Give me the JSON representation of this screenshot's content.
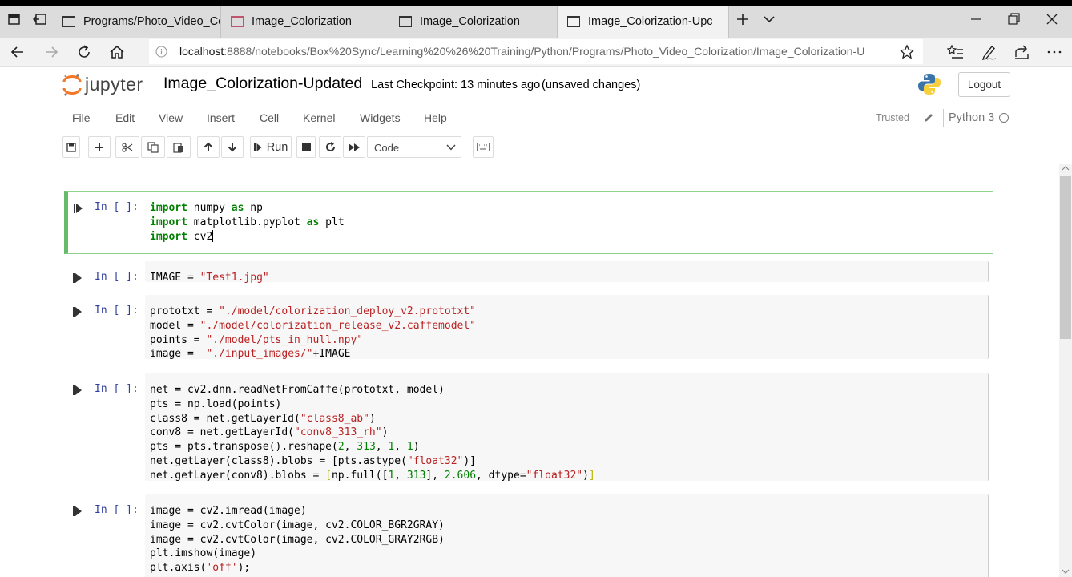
{
  "browser": {
    "tabs": [
      {
        "label": "Programs/Photo_Video_Col",
        "icon": "page-icon"
      },
      {
        "label": "Image_Colorization",
        "icon": "jupyter-page-icon"
      },
      {
        "label": "Image_Colorization",
        "icon": "page-icon"
      },
      {
        "label": "Image_Colorization-Upc",
        "icon": "page-icon",
        "active": true
      }
    ],
    "url_host": "localhost",
    "url_rest": ":8888/notebooks/Box%20Sync/Learning%20%26%20Training/Python/Programs/Photo_Video_Colorization/Image_Colorization-Update"
  },
  "jupyter": {
    "logo_text": "jupyter",
    "notebook_title": "Image_Colorization-Updated",
    "checkpoint": "Last Checkpoint: 13 minutes ago",
    "unsaved": "(unsaved changes)",
    "logout": "Logout",
    "menu": [
      "File",
      "Edit",
      "View",
      "Insert",
      "Cell",
      "Kernel",
      "Widgets",
      "Help"
    ],
    "trusted": "Trusted",
    "kernel_name": "Python 3",
    "toolbar": {
      "run_label": "Run",
      "cell_type": "Code"
    }
  },
  "cells": [
    {
      "prompt": "In [ ]:",
      "lines": [
        "import numpy as np",
        "import matplotlib.pyplot as plt",
        "import cv2"
      ]
    },
    {
      "prompt": "In [ ]:",
      "lines": [
        "IMAGE = \"Test1.jpg\""
      ]
    },
    {
      "prompt": "In [ ]:",
      "lines": [
        "prototxt = \"./model/colorization_deploy_v2.prototxt\"",
        "model = \"./model/colorization_release_v2.caffemodel\"",
        "points = \"./model/pts_in_hull.npy\"",
        "image =  \"./input_images/\"+IMAGE"
      ]
    },
    {
      "prompt": "In [ ]:",
      "lines": [
        "net = cv2.dnn.readNetFromCaffe(prototxt, model)",
        "pts = np.load(points)",
        "class8 = net.getLayerId(\"class8_ab\")",
        "conv8 = net.getLayerId(\"conv8_313_rh\")",
        "pts = pts.transpose().reshape(2, 313, 1, 1)",
        "net.getLayer(class8).blobs = [pts.astype(\"float32\")]",
        "net.getLayer(conv8).blobs = [np.full([1, 313], 2.606, dtype=\"float32\")]"
      ]
    },
    {
      "prompt": "In [ ]:",
      "lines": [
        "image = cv2.imread(image)",
        "image = cv2.cvtColor(image, cv2.COLOR_BGR2GRAY)",
        "image = cv2.cvtColor(image, cv2.COLOR_GRAY2RGB)",
        "plt.imshow(image)",
        "plt.axis('off');"
      ]
    }
  ]
}
